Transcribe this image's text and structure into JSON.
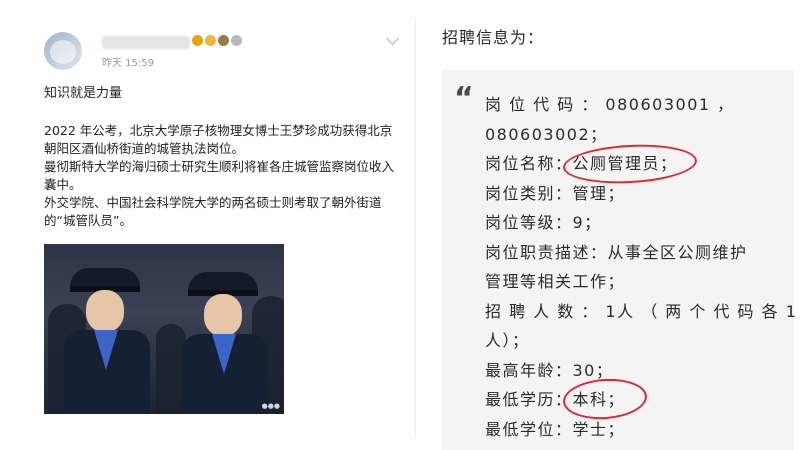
{
  "left_post": {
    "timestamp": "昨天 15:59",
    "headline": "知识就是力量",
    "body": [
      "2022 年公考，北京大学原子核物理女博士王梦珍成功获得北京朝阳区酒仙桥街道的城管执法岗位。",
      "曼彻斯特大学的海归硕士研究生顺利将崔各庄城管监察岗位收入囊中。",
      "外交学院、中国社会科学院大学的两名硕士则考取了朝外街道的“城管队员”。"
    ],
    "photo_name": "officers-photo"
  },
  "right_panel": {
    "title": "招聘信息为：",
    "quote_mark": "“",
    "lines": [
      "岗 位 代 码 ： 080603001 ，",
      "080603002；",
      {
        "pre": "岗位名称：",
        "mark": "公厕管理员；"
      },
      "岗位类别：管理；",
      "岗位等级：9；",
      "岗位职责描述：从事全区公厕维护",
      "管理等相关工作；",
      "招 聘 人 数 ： 1人 （ 两 个 代 码 各 1",
      "人）；",
      "最高年龄：30；",
      {
        "pre": "最低学历：",
        "mark": "本科；"
      },
      "最低学位：学士；"
    ]
  },
  "colors": {
    "annotation_red": "#e0282b",
    "card_bg": "#f4f4f4",
    "uniform_navy": "#162033"
  }
}
